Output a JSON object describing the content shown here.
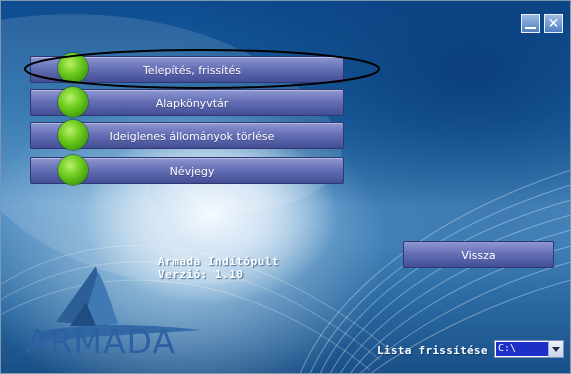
{
  "window": {
    "minimize_icon": "minimize-icon",
    "close_icon": "close-icon",
    "close_glyph": "✕"
  },
  "menu": {
    "items": [
      {
        "label": "Telepítés, frissítés"
      },
      {
        "label": "Alapkönyvtár"
      },
      {
        "label": "Ideiglenes állományok törlése"
      },
      {
        "label": "Névjegy"
      }
    ]
  },
  "back_button": {
    "label": "Vissza"
  },
  "app_info": {
    "title": "Armada Indítópult",
    "version": "Verzió: 1.10"
  },
  "logo": {
    "text": "ARMADA"
  },
  "refresh": {
    "label": "Lista frissítése ->",
    "drive": "C:\\"
  },
  "colors": {
    "button_gradient_top": "#8f98d2",
    "button_gradient_bottom": "#434d94",
    "orb_green": "#6fcc1f",
    "logo_blue": "#2b61a2",
    "select_highlight": "#1c2fc7",
    "background_deep_blue": "#0d4b8e"
  }
}
